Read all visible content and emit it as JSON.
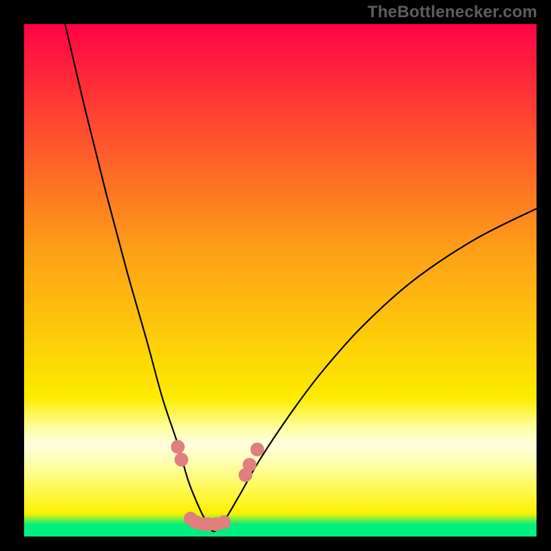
{
  "watermark": "TheBottlenecker.com",
  "chart_data": {
    "type": "line",
    "title": "",
    "xlabel": "",
    "ylabel": "",
    "xlim": [
      0,
      100
    ],
    "ylim": [
      0,
      100
    ],
    "grid": false,
    "background_gradient": {
      "top_color": "#fe0345",
      "mid_color": "#fde700",
      "bottom_main_color": "#00ef7e",
      "stops": [
        {
          "offset": 0.0,
          "color": "#fe0345"
        },
        {
          "offset": 0.44,
          "color": "#fd9f17"
        },
        {
          "offset": 0.73,
          "color": "#fdec00"
        },
        {
          "offset": 0.79,
          "color": "#feffa7"
        },
        {
          "offset": 0.82,
          "color": "#fffee1"
        },
        {
          "offset": 0.86,
          "color": "#feffa7"
        },
        {
          "offset": 0.955,
          "color": "#fdf100"
        },
        {
          "offset": 0.977,
          "color": "#00ef7e"
        },
        {
          "offset": 1.0,
          "color": "#00ef7e"
        }
      ]
    },
    "series": [
      {
        "name": "bottleneck-curve",
        "color": "#000000",
        "x": [
          8,
          12,
          16,
          20,
          24,
          27,
          30,
          32,
          34,
          35.5,
          37,
          39,
          42,
          46,
          52,
          58,
          66,
          76,
          88,
          100
        ],
        "y": [
          100,
          83,
          67,
          52,
          38,
          27,
          18,
          11,
          6,
          3,
          1,
          3,
          8,
          15,
          24,
          32,
          41,
          50,
          58,
          64
        ]
      }
    ],
    "markers": {
      "name": "highlight-dots",
      "color": "#e07f7e",
      "radius_px": 10,
      "points": [
        {
          "x": 30.0,
          "y": 17.5
        },
        {
          "x": 30.7,
          "y": 15.0
        },
        {
          "x": 32.5,
          "y": 3.5
        },
        {
          "x": 33.5,
          "y": 2.8
        },
        {
          "x": 35.0,
          "y": 2.4
        },
        {
          "x": 36.0,
          "y": 2.4
        },
        {
          "x": 37.5,
          "y": 2.4
        },
        {
          "x": 39.0,
          "y": 2.8
        },
        {
          "x": 43.2,
          "y": 12.0
        },
        {
          "x": 44.0,
          "y": 14.0
        },
        {
          "x": 45.5,
          "y": 17.0
        }
      ]
    }
  }
}
